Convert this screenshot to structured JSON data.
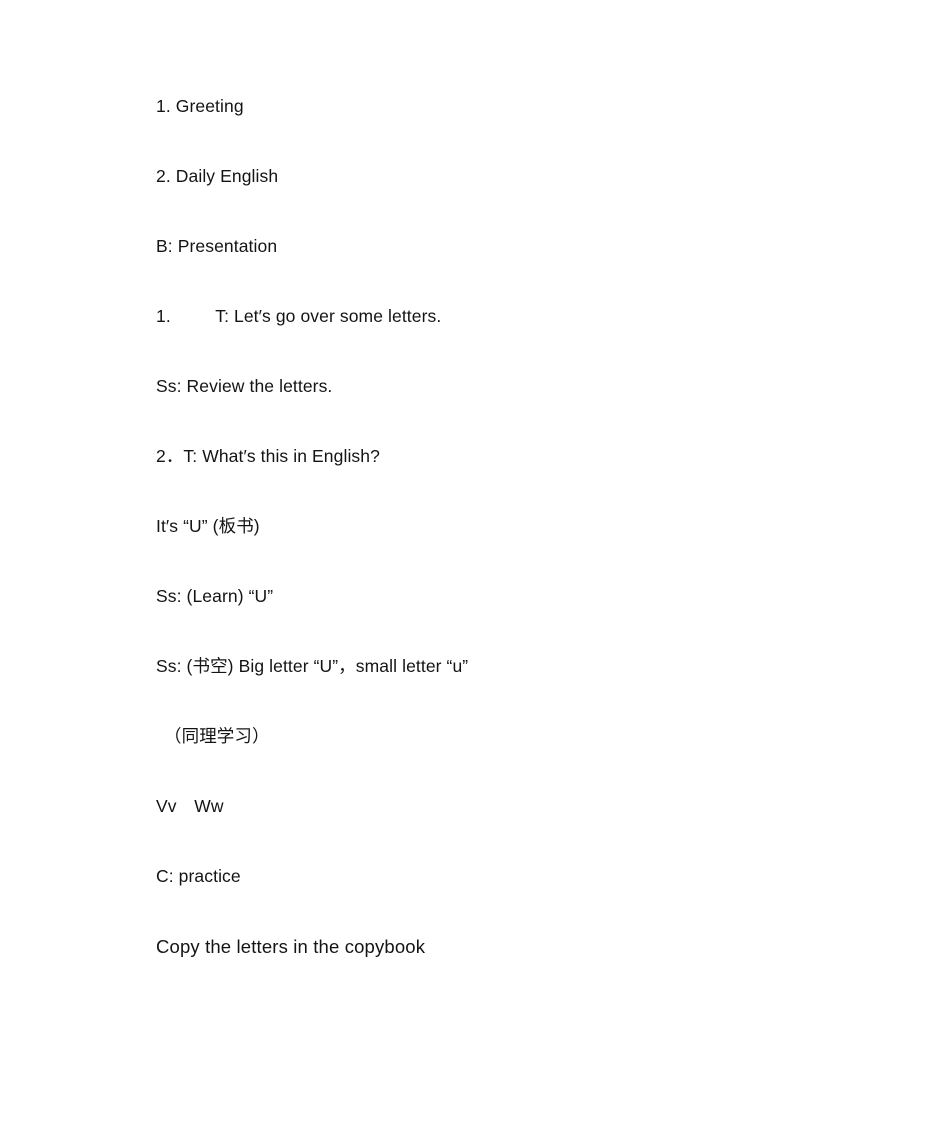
{
  "document": {
    "background_color": "#ffffff",
    "text_color": "#141414",
    "lines": [
      {
        "id": "line-1",
        "text": "1. Greeting"
      },
      {
        "id": "line-2",
        "text": "2. Daily English"
      },
      {
        "id": "line-3",
        "text": "B: Presentation"
      },
      {
        "id": "line-4",
        "text": "1.\t    T: Let′s go over some letters."
      },
      {
        "id": "line-5",
        "text": "Ss: Review the letters."
      },
      {
        "id": "line-6",
        "text": "2．T: What′s this in English?"
      },
      {
        "id": "line-7",
        "text": "It′s “U” (板书)"
      },
      {
        "id": "line-8",
        "text": "Ss: (Learn) “U”"
      },
      {
        "id": "line-9",
        "text": "Ss: (书空) Big letter “U”，small letter “u”"
      },
      {
        "id": "line-10",
        "text": "（同理学习）"
      },
      {
        "id": "line-11",
        "text": "Vv　Ww"
      },
      {
        "id": "line-12",
        "text": "C: practice"
      },
      {
        "id": "line-13",
        "text": "Copy the letters in the copybook"
      }
    ]
  }
}
